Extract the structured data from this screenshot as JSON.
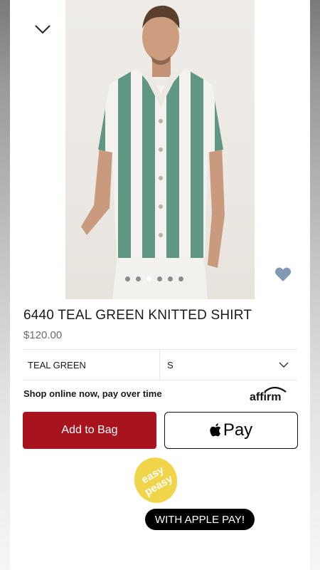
{
  "product": {
    "title": "6440 TEAL GREEN KNITTED SHIRT",
    "price": "$120.00",
    "image": {
      "dots_total": 6,
      "active_dot": 2
    }
  },
  "options": {
    "color_value": "TEAL GREEN",
    "size_value": "S"
  },
  "financing": {
    "text": "Shop online now, pay over time",
    "provider_logo": "affirm"
  },
  "actions": {
    "add_to_bag_label": "Add to Bag",
    "apple_pay_label": "Pay"
  },
  "promo": {
    "sticker_line1": "easy",
    "sticker_line2": "peasy",
    "pill_text": "WITH APPLE PAY!"
  },
  "colors": {
    "primary_red": "#a8141e",
    "stripe_green": "#5f9783",
    "heart": "#7f9bb3",
    "sticker_yellow": "#f0d44a"
  },
  "icons": [
    "chevron-down-icon",
    "heart-icon",
    "apple-logo-icon",
    "affirm-logo"
  ]
}
